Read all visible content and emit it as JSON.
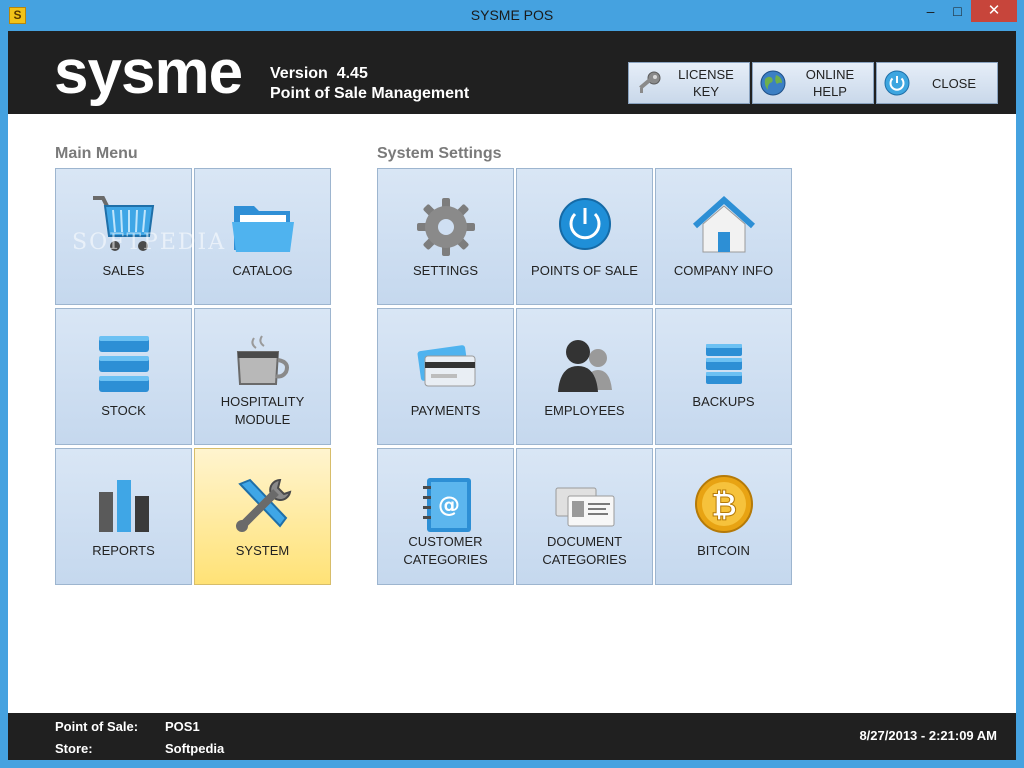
{
  "window": {
    "title": "SYSME POS",
    "app_icon_letter": "S",
    "min_glyph": "–",
    "max_glyph": "□",
    "close_glyph": "✕"
  },
  "header": {
    "logo": "sysme",
    "version_label": "Version",
    "version_number": "4.45",
    "subtitle": "Point of Sale Management",
    "buttons": [
      {
        "label": "LICENSE KEY",
        "icon": "key-icon"
      },
      {
        "label": "ONLINE\nHELP",
        "icon": "globe-icon"
      },
      {
        "label": "CLOSE",
        "icon": "power-icon"
      }
    ]
  },
  "main_menu": {
    "title": "Main Menu",
    "tiles": [
      {
        "label": "SALES",
        "icon": "cart-icon"
      },
      {
        "label": "CATALOG",
        "icon": "folder-icon"
      },
      {
        "label": "STOCK",
        "icon": "database-icon"
      },
      {
        "label": "HOSPITALITY\nMODULE",
        "icon": "coffee-cup-icon"
      },
      {
        "label": "REPORTS",
        "icon": "bar-chart-icon"
      },
      {
        "label": "SYSTEM",
        "icon": "tools-icon",
        "active": true
      }
    ]
  },
  "system_settings": {
    "title": "System Settings",
    "tiles": [
      {
        "label": "SETTINGS",
        "icon": "gear-icon"
      },
      {
        "label": "POINTS OF SALE",
        "icon": "power-button-icon"
      },
      {
        "label": "COMPANY INFO",
        "icon": "home-icon"
      },
      {
        "label": "PAYMENTS",
        "icon": "credit-cards-icon"
      },
      {
        "label": "EMPLOYEES",
        "icon": "users-icon"
      },
      {
        "label": "BACKUPS",
        "icon": "database-small-icon"
      },
      {
        "label": "CUSTOMER\nCATEGORIES",
        "icon": "address-book-icon"
      },
      {
        "label": "DOCUMENT\nCATEGORIES",
        "icon": "id-cards-icon"
      },
      {
        "label": "BITCOIN",
        "icon": "bitcoin-icon"
      }
    ]
  },
  "footer": {
    "pos_label": "Point of Sale:",
    "pos_value": "POS1",
    "store_label": "Store:",
    "store_value": "Softpedia",
    "datetime": "8/27/2013 - 2:21:09 AM"
  },
  "watermark": "SOFTPEDIA",
  "colors": {
    "accent": "#45a2e0",
    "header_bg": "#202020",
    "tile_bg": "#cfdff2",
    "tile_active": "#ffe27a"
  }
}
